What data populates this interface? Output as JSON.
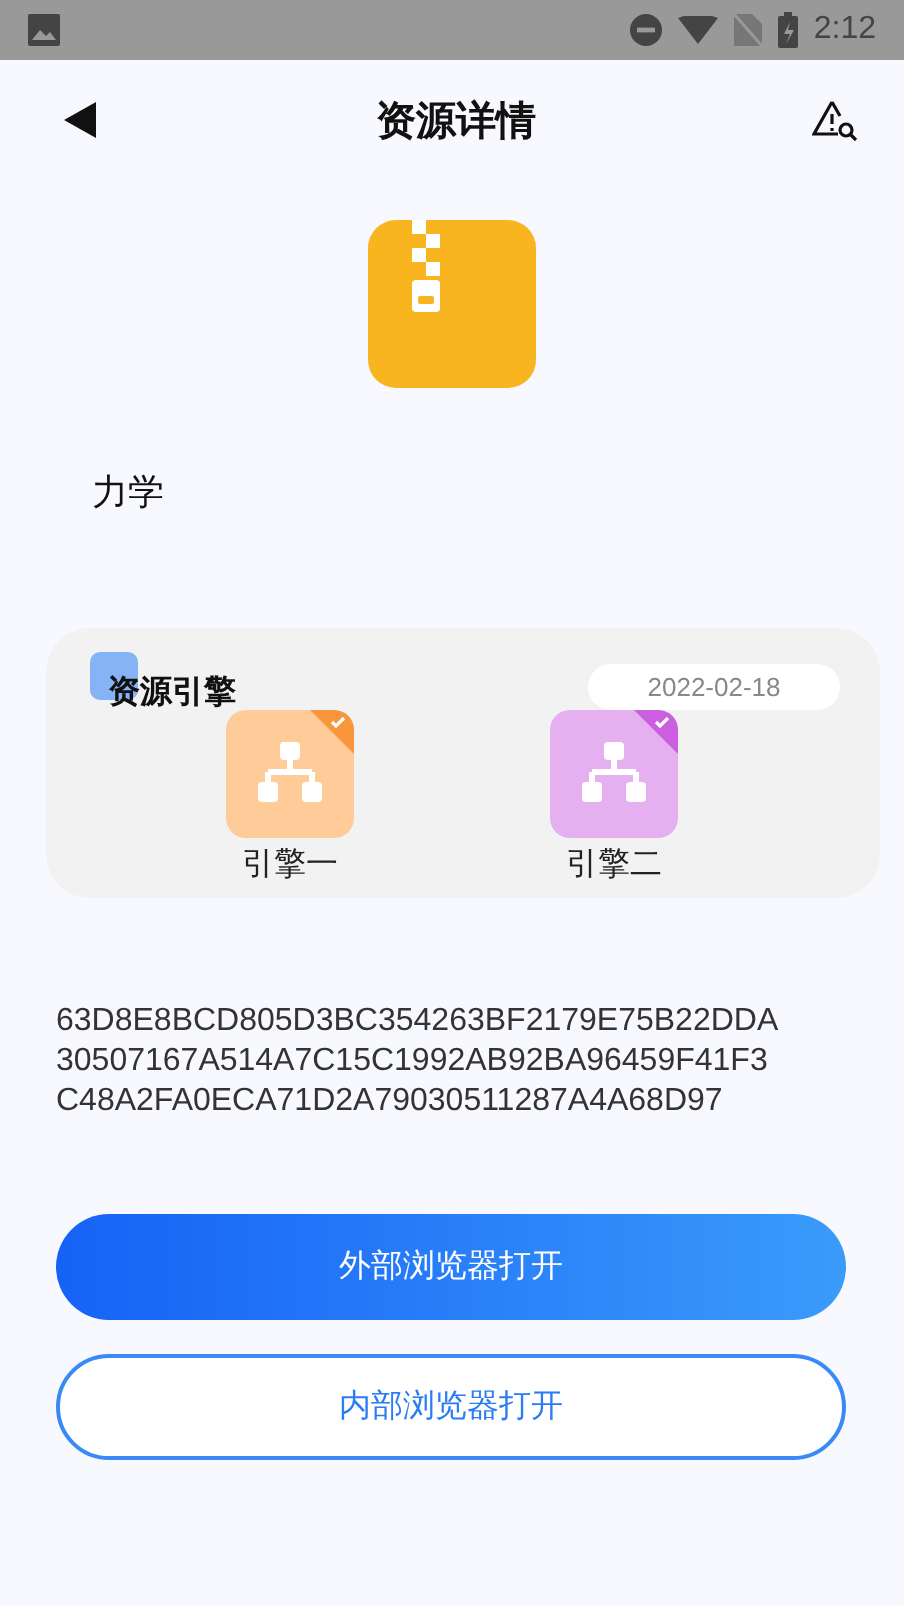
{
  "status_bar": {
    "time": "2:12"
  },
  "header": {
    "title": "资源详情"
  },
  "resource": {
    "name": "力学"
  },
  "engine_card": {
    "title": "资源引擎",
    "date": "2022-02-18",
    "engines": [
      {
        "label": "引擎一",
        "color": "#ffcc99",
        "selected": true
      },
      {
        "label": "引擎二",
        "color": "#e4b0f0",
        "selected": true
      }
    ]
  },
  "link_lines": [
    "63D8E8BCD805D3BC354263BF2179E75B22DDA",
    "30507167A514A7C15C1992AB92BA96459F41F3",
    "C48A2FA0ECA71D2A79030511287A4A68D97"
  ],
  "buttons": [
    {
      "label": "外部浏览器打开",
      "kind": "primary"
    },
    {
      "label": "内部浏览器打开",
      "kind": "outline"
    }
  ]
}
